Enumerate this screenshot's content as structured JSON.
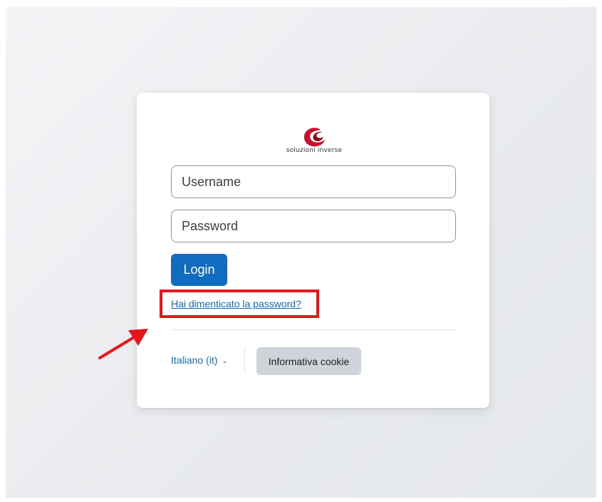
{
  "logo": {
    "text": "soluzioni inverse",
    "brand_color": "#c8102e"
  },
  "login_form": {
    "username_placeholder": "Username",
    "password_placeholder": "Password",
    "login_label": "Login",
    "forgot_password_label": "Hai dimenticato la password?"
  },
  "footer": {
    "language_label": "Italiano (it)",
    "language_chevron": "chevron-down-icon",
    "cookie_button_label": "Informativa cookie"
  },
  "annotation": {
    "highlight_color": "#e8151b",
    "arrow_icon": "red-arrow-icon"
  },
  "colors": {
    "primary": "#0f6cbf",
    "secondary_button": "#ced4da"
  }
}
